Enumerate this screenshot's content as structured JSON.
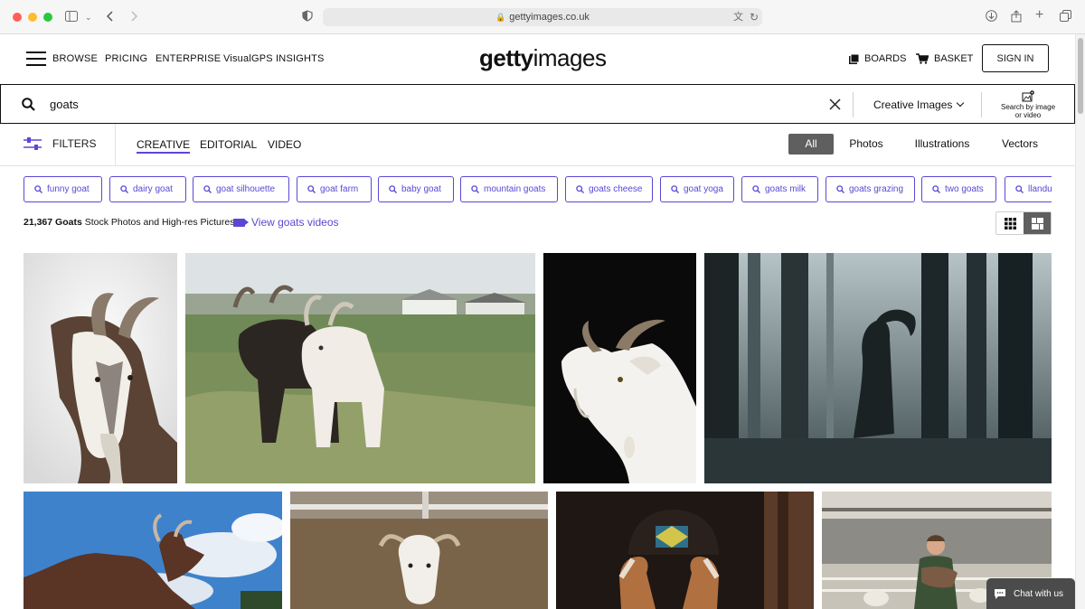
{
  "browser": {
    "url": "gettyimages.co.uk"
  },
  "header": {
    "nav": [
      "BROWSE",
      "PRICING",
      "ENTERPRISE",
      "VisualGPS INSIGHTS"
    ],
    "logo_bold": "getty",
    "logo_light": "images",
    "boards": "BOARDS",
    "basket": "BASKET",
    "sign_in": "SIGN IN"
  },
  "search": {
    "query": "goats",
    "content_type": "Creative Images",
    "search_by_image_line1": "Search by image",
    "search_by_image_line2": "or video"
  },
  "filterbar": {
    "filters_label": "FILTERS",
    "tabs": [
      "CREATIVE",
      "EDITORIAL",
      "VIDEO"
    ],
    "active_tab": "CREATIVE",
    "types": [
      "All",
      "Photos",
      "Illustrations",
      "Vectors"
    ],
    "active_type": "All"
  },
  "related_searches": [
    "funny goat",
    "dairy goat",
    "goat silhouette",
    "goat farm",
    "baby goat",
    "mountain goats",
    "goats cheese",
    "goat yoga",
    "goats milk",
    "goats grazing",
    "two goats",
    "llandudno goats"
  ],
  "results": {
    "count": "21,367",
    "keyword": "Goats",
    "suffix": "Stock Photos and High-res Pictures",
    "video_link": "View goats videos"
  },
  "images": [
    {
      "name": "white-goat-portrait-photo"
    },
    {
      "name": "black-and-white-goats-field-photo"
    },
    {
      "name": "white-goat-black-background-photo"
    },
    {
      "name": "goat-silhouette-forest-photo"
    },
    {
      "name": "brown-goat-sky-photo"
    },
    {
      "name": "white-goat-farmyard-photo"
    },
    {
      "name": "two-goats-barn-photo"
    },
    {
      "name": "farmer-holding-goat-photo"
    }
  ],
  "chat": {
    "label": "Chat with us"
  },
  "colors": {
    "accent": "#5948d6",
    "active_pill": "#5f5f5f"
  }
}
